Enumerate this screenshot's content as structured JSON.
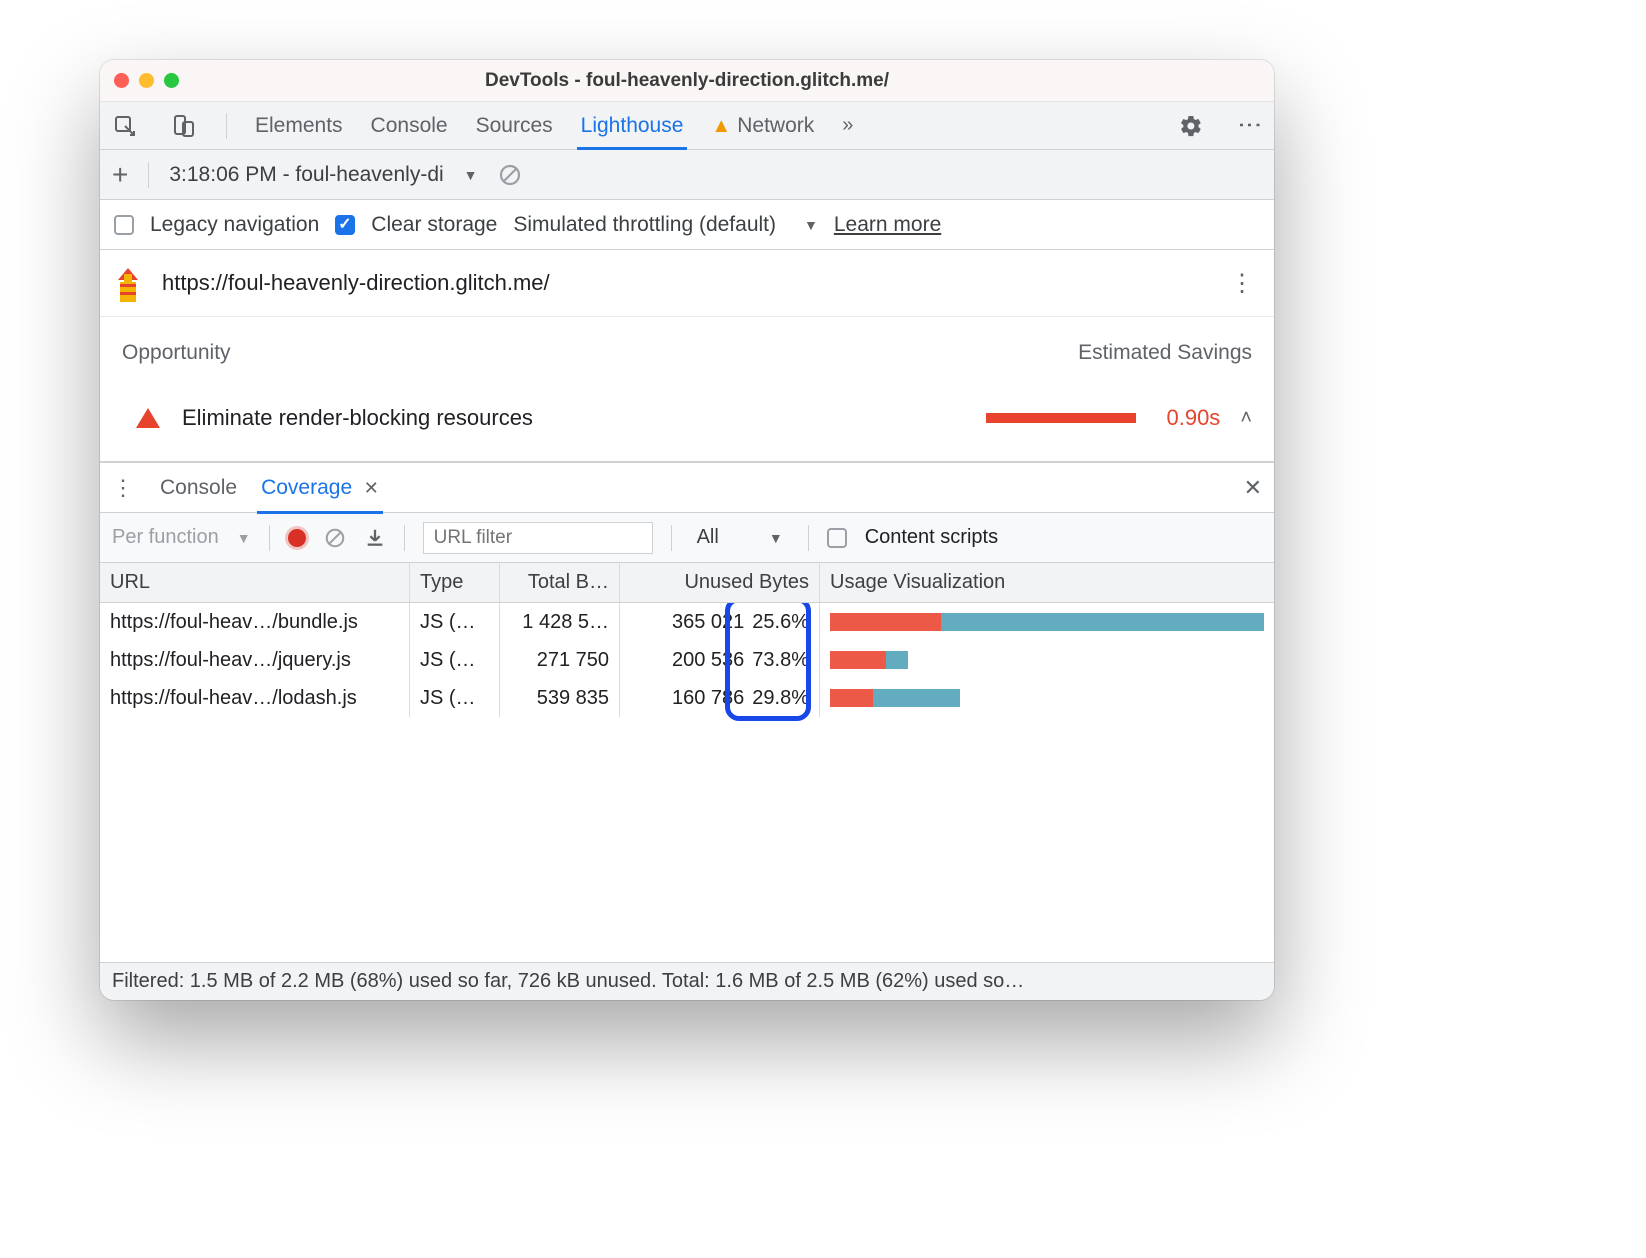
{
  "window": {
    "title": "DevTools - foul-heavenly-direction.glitch.me/"
  },
  "tabs": {
    "items": [
      {
        "label": "Elements"
      },
      {
        "label": "Console"
      },
      {
        "label": "Sources"
      },
      {
        "label": "Lighthouse"
      },
      {
        "label": "Network"
      }
    ],
    "active": "Lighthouse"
  },
  "lighthouse": {
    "report_dropdown": "3:18:06 PM - foul-heavenly-di",
    "settings": {
      "legacy_label": "Legacy navigation",
      "legacy_checked": false,
      "clear_storage_label": "Clear storage",
      "clear_storage_checked": true,
      "throttling_label": "Simulated throttling (default)",
      "learn_more": "Learn more"
    },
    "url": "https://foul-heavenly-direction.glitch.me/",
    "opportunity_header": "Opportunity",
    "estimated_savings_header": "Estimated Savings",
    "opportunity": {
      "title": "Eliminate render-blocking resources",
      "savings": "0.90s"
    }
  },
  "drawer": {
    "tabs": [
      {
        "label": "Console"
      },
      {
        "label": "Coverage"
      }
    ],
    "active": "Coverage"
  },
  "coverage": {
    "mode": "Per function",
    "filter_placeholder": "URL filter",
    "type_filter": "All",
    "content_scripts_label": "Content scripts",
    "columns": {
      "url": "URL",
      "type": "Type",
      "total": "Total B…",
      "unused": "Unused Bytes",
      "viz": "Usage Visualization"
    },
    "rows": [
      {
        "url": "https://foul-heav…/bundle.js",
        "type": "JS (…",
        "total": "1 428 5…",
        "unused_bytes": "365 021",
        "unused_pct": "25.6%",
        "red_pct": 25.6,
        "blue_pct": 74.4
      },
      {
        "url": "https://foul-heav…/jquery.js",
        "type": "JS (…",
        "total": "271 750",
        "unused_bytes": "200 536",
        "unused_pct": "73.8%",
        "red_pct": 13,
        "blue_pct": 5
      },
      {
        "url": "https://foul-heav…/lodash.js",
        "type": "JS (…",
        "total": "539 835",
        "unused_bytes": "160 786",
        "unused_pct": "29.8%",
        "red_pct": 10,
        "blue_pct": 20
      }
    ],
    "status": "Filtered: 1.5 MB of 2.2 MB (68%) used so far, 726 kB unused. Total: 1.6 MB of 2.5 MB (62%) used so…"
  }
}
